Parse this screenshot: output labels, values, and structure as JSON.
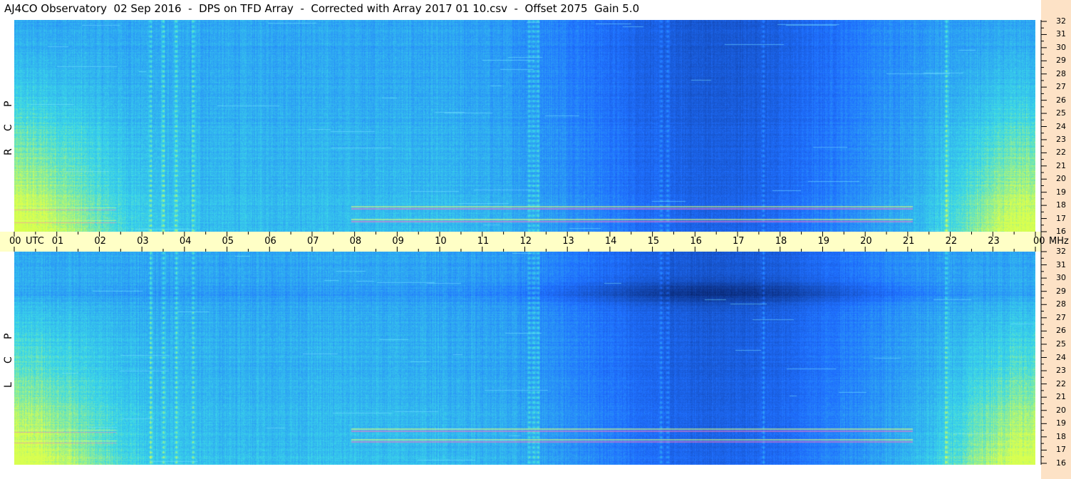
{
  "title": "AJ4CO Observatory  02 Sep 2016  -  DPS on TFD Array  -  Corrected with Array 2017 01 10.csv  -  Offset 2075  Gain 5.0",
  "chart_data": {
    "type": "heatmap",
    "title": "AJ4CO Observatory  02 Sep 2016  -  DPS on TFD Array  -  Corrected with Array 2017 01 10.csv  -  Offset 2075  Gain 5.0",
    "x_axis": {
      "unit": "UTC",
      "ticks": [
        "00",
        "01",
        "02",
        "03",
        "04",
        "05",
        "06",
        "07",
        "08",
        "09",
        "10",
        "11",
        "12",
        "13",
        "14",
        "15",
        "16",
        "17",
        "18",
        "19",
        "20",
        "21",
        "22",
        "23",
        "00"
      ],
      "range": [
        0,
        24
      ]
    },
    "y_axis": {
      "unit": "MHz",
      "ticks": [
        "32",
        "31",
        "30",
        "29",
        "28",
        "27",
        "26",
        "25",
        "24",
        "23",
        "22",
        "21",
        "20",
        "19",
        "18",
        "17",
        "16"
      ],
      "range": [
        16,
        32
      ]
    },
    "panels": [
      {
        "name": "RCP",
        "letters": [
          "R",
          "C",
          "P"
        ]
      },
      {
        "name": "LCP",
        "letters": [
          "L",
          "C",
          "P"
        ]
      }
    ],
    "colors": {
      "low": "#08246e",
      "mid": "#1f6fff",
      "high": "#3bd8e8",
      "hot": "#d8ff50",
      "axis_band": "#ffffc6",
      "right_strip": "#fde2c6"
    }
  }
}
